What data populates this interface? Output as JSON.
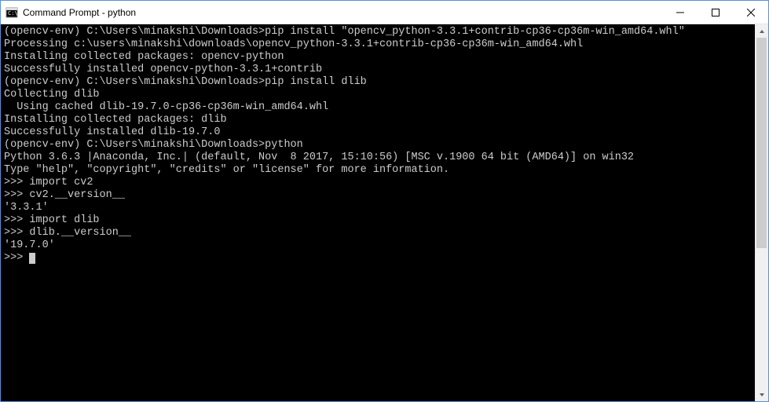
{
  "window": {
    "title": "Command Prompt - python"
  },
  "terminal": {
    "lines": [
      "",
      "(opencv-env) C:\\Users\\minakshi\\Downloads>pip install \"opencv_python-3.3.1+contrib-cp36-cp36m-win_amd64.whl\"",
      "Processing c:\\users\\minakshi\\downloads\\opencv_python-3.3.1+contrib-cp36-cp36m-win_amd64.whl",
      "Installing collected packages: opencv-python",
      "Successfully installed opencv-python-3.3.1+contrib",
      "",
      "(opencv-env) C:\\Users\\minakshi\\Downloads>pip install dlib",
      "Collecting dlib",
      "  Using cached dlib-19.7.0-cp36-cp36m-win_amd64.whl",
      "Installing collected packages: dlib",
      "Successfully installed dlib-19.7.0",
      "",
      "(opencv-env) C:\\Users\\minakshi\\Downloads>python",
      "Python 3.6.3 |Anaconda, Inc.| (default, Nov  8 2017, 15:10:56) [MSC v.1900 64 bit (AMD64)] on win32",
      "Type \"help\", \"copyright\", \"credits\" or \"license\" for more information.",
      ">>> import cv2",
      ">>> cv2.__version__",
      "'3.3.1'",
      ">>> import dlib",
      ">>> dlib.__version__",
      "'19.7.0'",
      ">>>"
    ]
  }
}
